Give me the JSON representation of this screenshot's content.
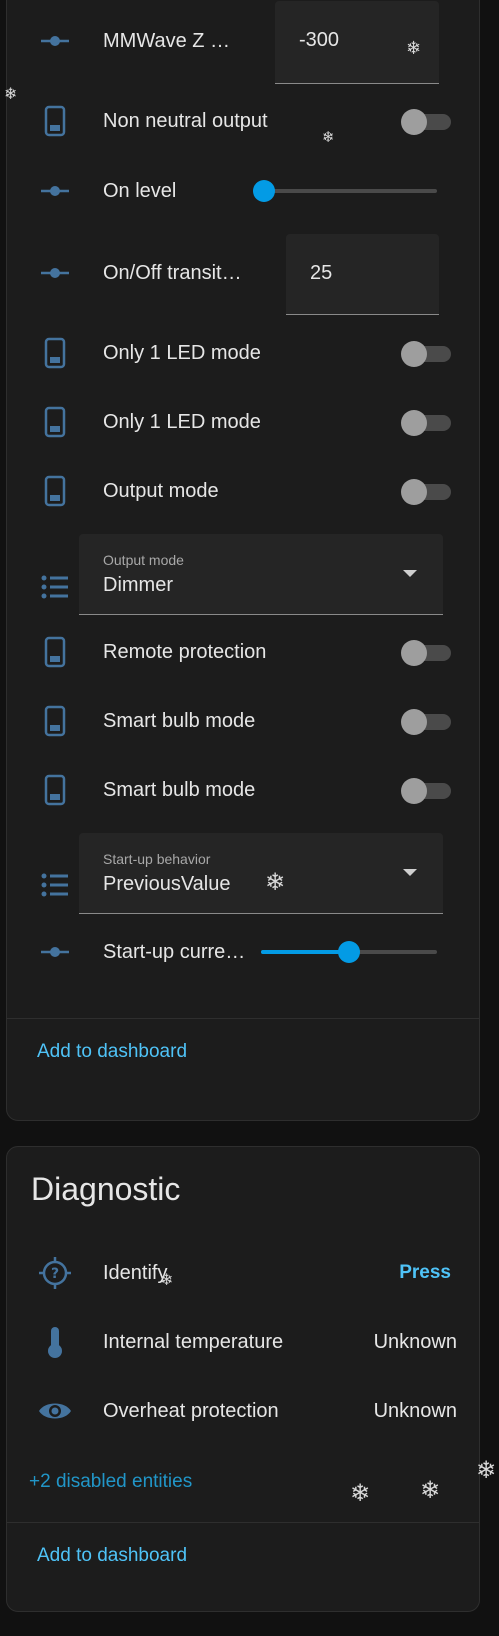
{
  "settings_card": {
    "mmwave": {
      "label": "MMWave Z …",
      "value": "-300"
    },
    "non_neutral": {
      "label": "Non neutral output"
    },
    "on_level": {
      "label": "On level",
      "level": 0
    },
    "onoff_transition": {
      "label": "On/Off transit…",
      "value": "25"
    },
    "only_led_1": {
      "label": "Only 1 LED mode"
    },
    "only_led_2": {
      "label": "Only 1 LED mode"
    },
    "output_mode_toggle": {
      "label": "Output mode"
    },
    "output_mode_select": {
      "label": "Output mode",
      "value": "Dimmer"
    },
    "remote_protection": {
      "label": "Remote protection"
    },
    "smart_bulb_1": {
      "label": "Smart bulb mode"
    },
    "smart_bulb_2": {
      "label": "Smart bulb mode"
    },
    "startup_behavior": {
      "label": "Start-up behavior",
      "value": "PreviousValue"
    },
    "startup_current": {
      "label": "Start-up curre…",
      "level": 0.5
    },
    "add_to_dashboard": "Add to dashboard"
  },
  "diagnostic_card": {
    "title": "Diagnostic",
    "identify": {
      "label": "Identify",
      "action": "Press"
    },
    "internal_temperature": {
      "label": "Internal temperature",
      "value": "Unknown"
    },
    "overheat_protection": {
      "label": "Overheat protection",
      "value": "Unknown"
    },
    "disabled_entities_link": "+2 disabled entities",
    "add_to_dashboard": "Add to dashboard"
  },
  "colors": {
    "icon": "#44739e",
    "accent": "#039be5",
    "link": "#4fc3f7"
  }
}
